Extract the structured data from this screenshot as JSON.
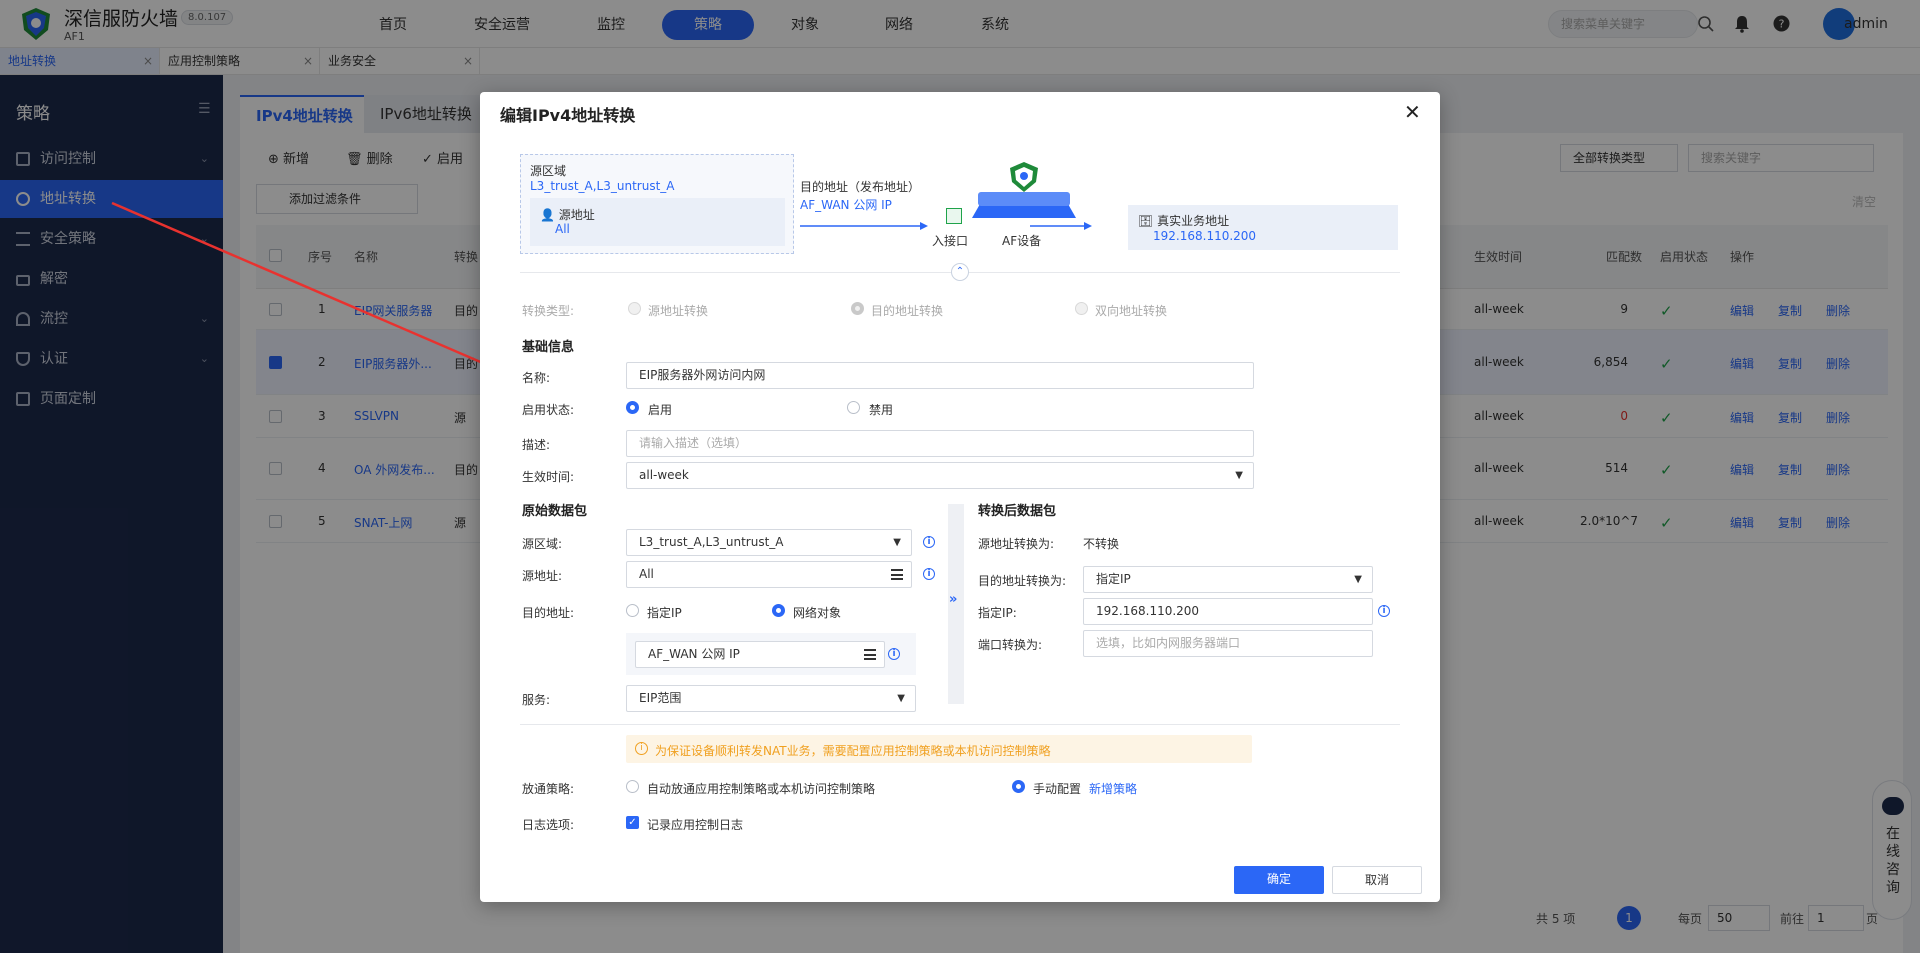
{
  "app": {
    "brand": "深信服防火墙",
    "model": "AF1",
    "version": "8.0.107"
  },
  "topnav": [
    "首页",
    "安全运营",
    "监控",
    "策略",
    "对象",
    "网络",
    "系统"
  ],
  "search_placeholder": "搜索菜单关键字",
  "user": "admin",
  "page_tabs": [
    "地址转换",
    "应用控制策略",
    "业务安全"
  ],
  "sidebar": {
    "title": "策略",
    "items": [
      "访问控制",
      "地址转换",
      "安全策略",
      "解密",
      "流控",
      "认证",
      "页面定制"
    ]
  },
  "main": {
    "tabs": [
      "IPv4地址转换",
      "IPv6地址转换"
    ],
    "toolbar": {
      "add": "新增",
      "delete": "删除",
      "enable": "启用",
      "filter": "添加过滤条件",
      "type_select": "全部转换类型",
      "search_placeholder": "搜索关键字",
      "clear": "清空"
    },
    "columns": {
      "seq": "序号",
      "name": "名称",
      "type": "转换",
      "time": "生效时间",
      "match": "匹配数",
      "status": "启用状态",
      "ops": "操作"
    },
    "rows": [
      {
        "seq": "1",
        "name": "EIP网关服务器",
        "type": "目的",
        "time": "all-week",
        "match": "9"
      },
      {
        "seq": "2",
        "name": "EIP服务器外...",
        "type": "目的",
        "time": "all-week",
        "match": "6,854"
      },
      {
        "seq": "3",
        "name": "SSLVPN",
        "type": "源",
        "time": "all-week",
        "match": "0"
      },
      {
        "seq": "4",
        "name": "OA 外网发布...",
        "type": "目的",
        "time": "all-week",
        "match": "514"
      },
      {
        "seq": "5",
        "name": "SNAT-上网",
        "type": "源",
        "time": "all-week",
        "match": "2.0*10^7"
      }
    ],
    "ops": {
      "edit": "编辑",
      "copy": "复制",
      "delete": "删除"
    },
    "pager": {
      "total": "共 5 项",
      "current": "1",
      "per_page_label": "每页",
      "per_page": "50",
      "goto_label": "前往",
      "goto": "1",
      "page_suffix": "页"
    }
  },
  "dialog": {
    "title": "编辑IPv4地址转换",
    "diagram": {
      "src_zone_label": "源区域",
      "src_zone_value": "L3_trust_A,L3_untrust_A",
      "src_addr_label": "源地址",
      "src_addr_value": "All",
      "dst_label": "目的地址（发布地址）",
      "dst_value": "AF_WAN 公网 IP",
      "in_if": "入接口",
      "device": "AF设备",
      "real_label": "真实业务地址",
      "real_value": "192.168.110.200"
    },
    "type_label": "转换类型:",
    "type_options": [
      "源地址转换",
      "目的地址转换",
      "双向地址转换"
    ],
    "basic_title": "基础信息",
    "name_label": "名称:",
    "name_value": "EIP服务器外网访问内网",
    "status_label": "启用状态:",
    "status_on": "启用",
    "status_off": "禁用",
    "desc_label": "描述:",
    "desc_placeholder": "请输入描述（选填）",
    "time_label": "生效时间:",
    "time_value": "all-week",
    "orig_title": "原始数据包",
    "src_zone_label": "源区域:",
    "src_zone_value": "L3_trust_A,L3_untrust_A",
    "src_addr_label": "源地址:",
    "src_addr_value": "All",
    "dst_addr_label": "目的地址:",
    "dst_opt_ip": "指定IP",
    "dst_opt_obj": "网络对象",
    "dst_obj_value": "AF_WAN 公网 IP",
    "service_label": "服务:",
    "service_value": "EIP范围",
    "trans_title": "转换后数据包",
    "src_trans_label": "源地址转换为:",
    "src_trans_value": "不转换",
    "dst_trans_label": "目的地址转换为:",
    "dst_trans_value": "指定IP",
    "spec_ip_label": "指定IP:",
    "spec_ip_value": "192.168.110.200",
    "port_label": "端口转换为:",
    "port_placeholder": "选填，比如内网服务器端口",
    "warning": "为保证设备顺利转发NAT业务，需要配置应用控制策略或本机访问控制策略",
    "policy_label": "放通策略:",
    "policy_auto": "自动放通应用控制策略或本机访问控制策略",
    "policy_manual": "手动配置",
    "policy_new": "新增策略",
    "log_label": "日志选项:",
    "log_value": "记录应用控制日志",
    "ok": "确定",
    "cancel": "取消"
  },
  "help_widget": "在线咨询"
}
